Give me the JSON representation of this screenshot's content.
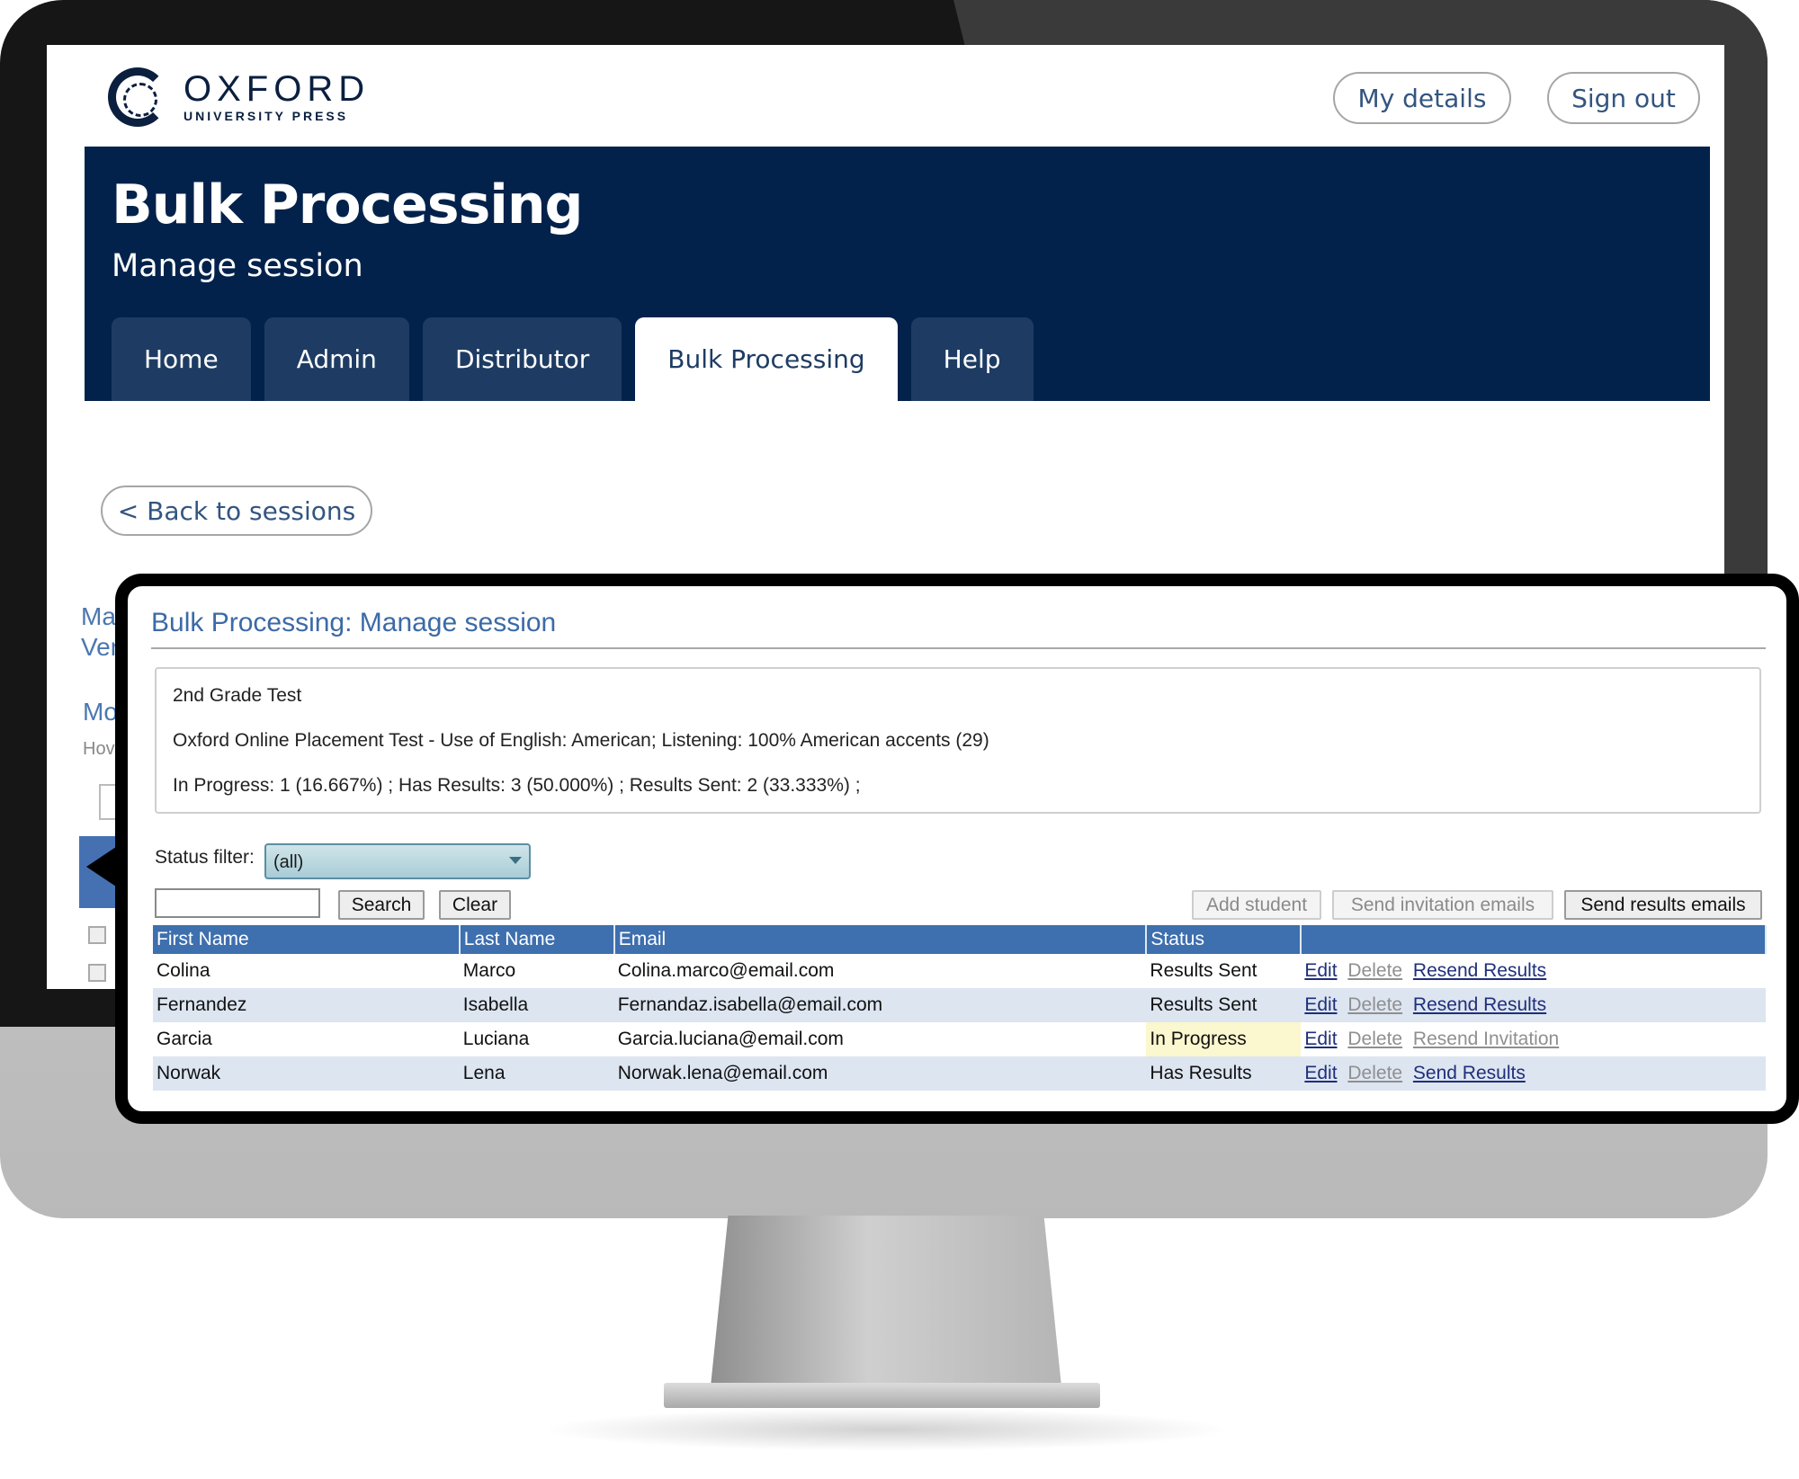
{
  "header": {
    "logo_title": "OXFORD",
    "logo_subtitle": "UNIVERSITY PRESS",
    "my_details_label": "My details",
    "sign_out_label": "Sign out"
  },
  "banner": {
    "title": "Bulk Processing",
    "subtitle": "Manage session",
    "tabs": [
      {
        "label": "Home",
        "active": false
      },
      {
        "label": "Admin",
        "active": false
      },
      {
        "label": "Distributor",
        "active": false
      },
      {
        "label": "Bulk Processing",
        "active": true
      },
      {
        "label": "Help",
        "active": false
      }
    ]
  },
  "back_button_label": "< Back to sessions",
  "background_fragments": {
    "line1": "Ma",
    "line2": "Ver",
    "line3": "Mo",
    "line4": "Hov"
  },
  "panel": {
    "title": "Bulk Processing: Manage session",
    "info": {
      "session_name": "2nd Grade Test",
      "test_description": "Oxford Online Placement Test - Use of English: American; Listening: 100% American accents (29)",
      "summary": "In Progress: 1 (16.667%) ; Has Results: 3 (50.000%) ; Results Sent: 2 (33.333%) ;"
    },
    "status_filter": {
      "label": "Status filter:",
      "selected": "(all)"
    },
    "search": {
      "value": "",
      "search_label": "Search",
      "clear_label": "Clear"
    },
    "actions": {
      "add_student_label": "Add student",
      "send_invitation_label": "Send invitation emails",
      "send_results_label": "Send results emails"
    },
    "table": {
      "columns": [
        "First Name",
        "Last Name",
        "Email",
        "Status",
        ""
      ],
      "rows": [
        {
          "first": "Colina",
          "last": "Marco",
          "email": "Colina.marco@email.com",
          "status": "Results Sent",
          "edit": "Edit",
          "delete": "Delete",
          "action": "Resend Results"
        },
        {
          "first": "Fernandez",
          "last": "Isabella",
          "email": "Fernandaz.isabella@email.com",
          "status": "Results Sent",
          "edit": "Edit",
          "delete": "Delete",
          "action": "Resend Results"
        },
        {
          "first": "Garcia",
          "last": "Luciana",
          "email": "Garcia.luciana@email.com",
          "status": "In Progress",
          "edit": "Edit",
          "delete": "Delete",
          "action": "Resend Invitation"
        },
        {
          "first": "Norwak",
          "last": "Lena",
          "email": "Norwak.lena@email.com",
          "status": "Has Results",
          "edit": "Edit",
          "delete": "Delete",
          "action": "Send Results"
        }
      ]
    }
  },
  "colors": {
    "banner": "#03224b",
    "tab": "#1e3c63",
    "table_header": "#3e6fae",
    "row_alt": "#dde5f1",
    "in_progress_highlight": "#fbf7cf",
    "panel_title": "#3c6aa6"
  },
  "icons": {
    "logo": "oxford-logo-icon",
    "dropdown": "chevron-down-icon"
  }
}
